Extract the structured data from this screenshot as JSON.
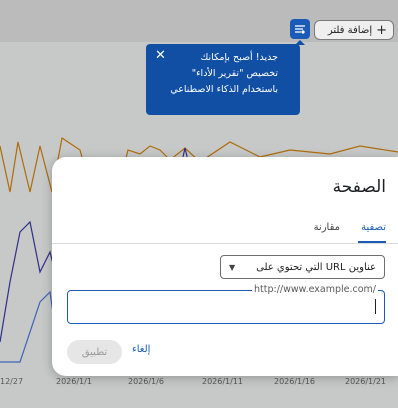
{
  "toolbar": {
    "add_filter_label": "إضافة فلتر",
    "filter_icon": "filter-settings-icon"
  },
  "tooltip": {
    "line1": "جديد! أصبح بإمكانك",
    "line2": "تخصيص \"تقرير الأداء\"",
    "line3": "باستخدام الذكاء الاصطناعي",
    "close_icon": "close-icon"
  },
  "chart_data": {
    "type": "line",
    "x": [
      "12/27",
      "2026/1/1",
      "2026/1/6",
      "2026/1/11",
      "2026/1/16",
      "2026/1/21"
    ],
    "series": [
      {
        "color": "#d4860e"
      },
      {
        "color": "#3b3aa6"
      },
      {
        "color": "#4f7ae0"
      }
    ]
  },
  "dialog": {
    "title": "الصفحة",
    "tabs": [
      "تصفية",
      "مقارنة"
    ],
    "active_tab": 0,
    "select_value": "عناوين URL التي تحتوي على",
    "url_placeholder": "http://www.example.com/",
    "url_value": "",
    "apply_label": "تطبيق",
    "cancel_label": "إلغاء"
  },
  "colors": {
    "accent": "#1a5bb8",
    "tooltip_bg": "#114fa5"
  }
}
